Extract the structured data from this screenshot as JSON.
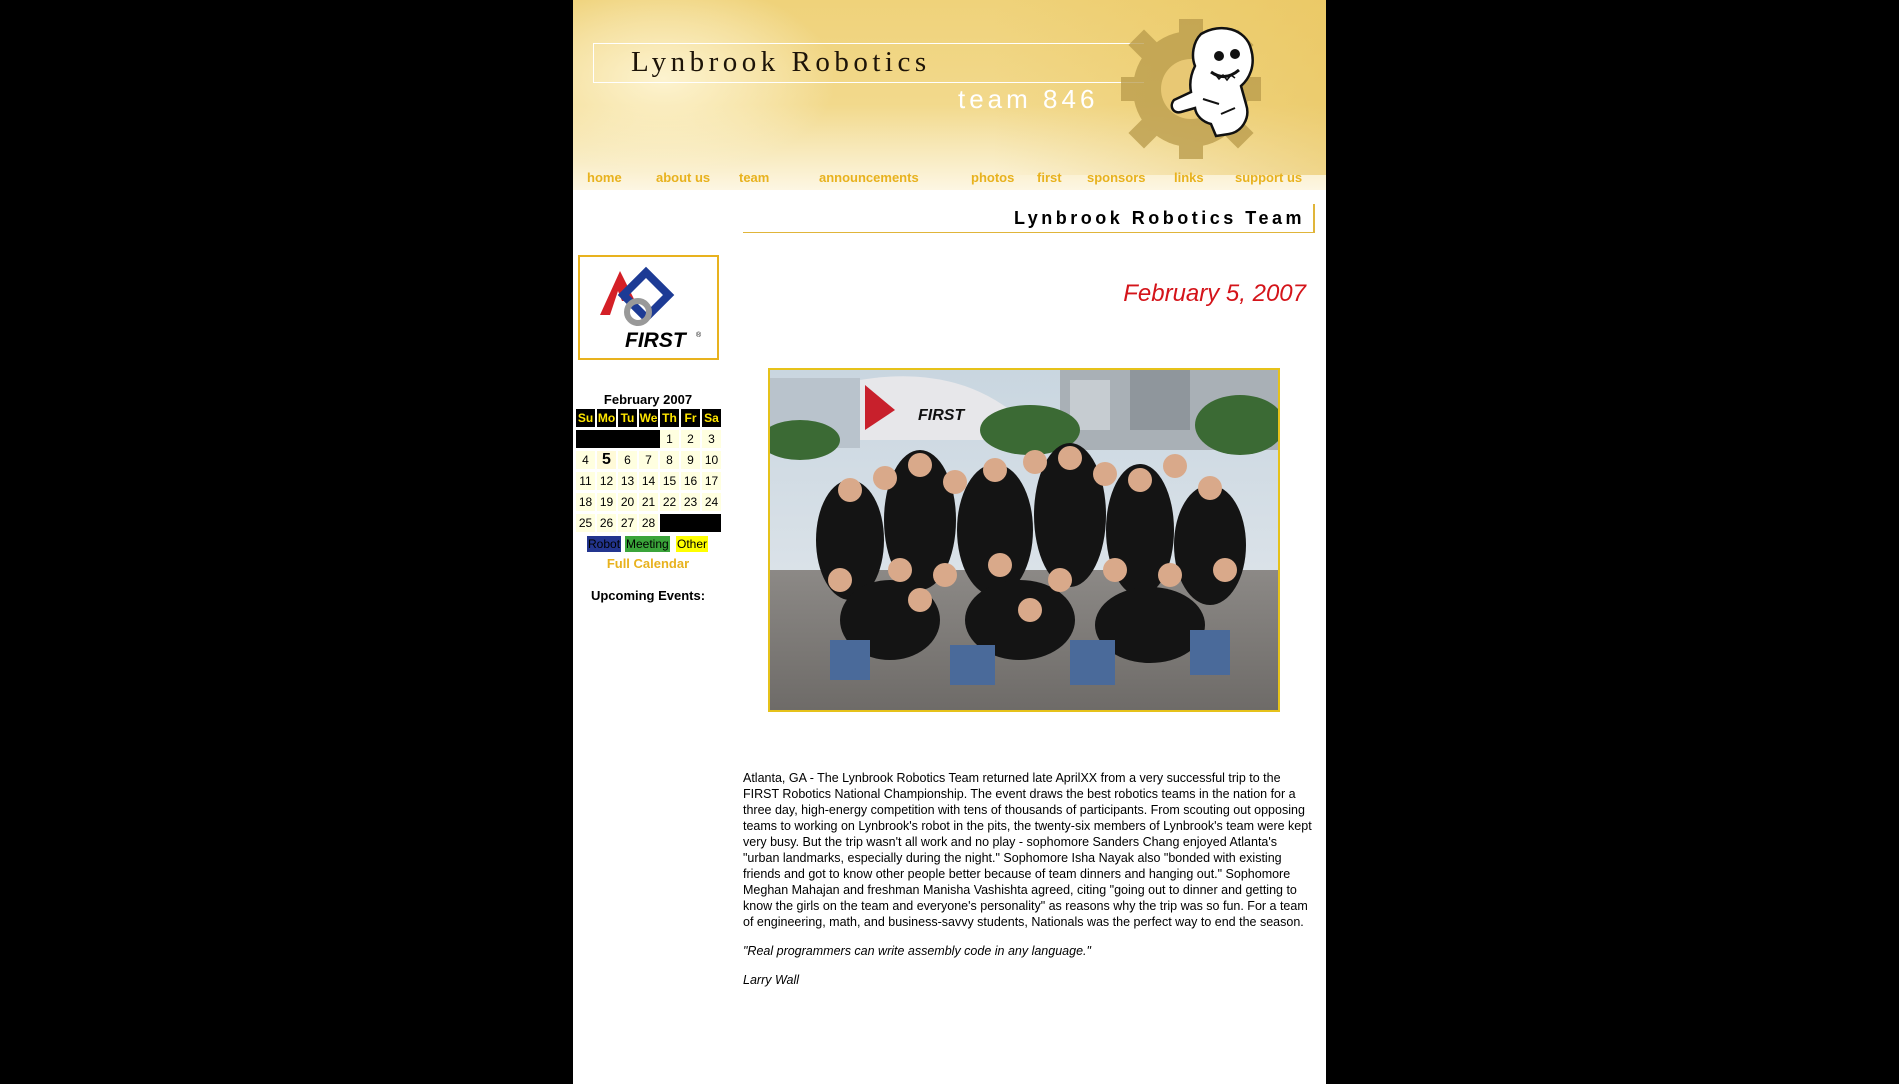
{
  "header": {
    "site_title": "Lynbrook Robotics",
    "team_number": "team 846"
  },
  "nav": {
    "items": [
      "home",
      "about us",
      "team",
      "announcements",
      "photos",
      "first",
      "sponsors",
      "links",
      "support us"
    ]
  },
  "section_title": "Lynbrook Robotics Team",
  "sidebar": {
    "logo_text": "FIRST",
    "calendar": {
      "month_label": "February 2007",
      "day_headers": [
        "Su",
        "Mo",
        "Tu",
        "We",
        "Th",
        "Fr",
        "Sa"
      ],
      "weeks": [
        [
          "",
          "",
          "",
          "",
          "1",
          "2",
          "3"
        ],
        [
          "4",
          "5",
          "6",
          "7",
          "8",
          "9",
          "10"
        ],
        [
          "11",
          "12",
          "13",
          "14",
          "15",
          "16",
          "17"
        ],
        [
          "18",
          "19",
          "20",
          "21",
          "22",
          "23",
          "24"
        ],
        [
          "25",
          "26",
          "27",
          "28",
          "",
          "",
          ""
        ]
      ],
      "today": "5",
      "legend": {
        "robot": "Robot",
        "meeting": "Meeting",
        "other": "Other"
      },
      "legend_colors": {
        "robot": "#23358f",
        "meeting": "#3aa43a",
        "other": "#ffff00"
      },
      "full_calendar_label": "Full Calendar",
      "upcoming_label": "Upcoming Events:"
    }
  },
  "main": {
    "date": "February 5, 2007",
    "photo_banner_text": "FIRST",
    "article_text": "Atlanta, GA - The Lynbrook Robotics Team returned late AprilXX from a very successful trip to the FIRST Robotics National Championship. The event draws the best robotics teams in the nation for a three day, high-energy competition with tens of thousands of participants. From scouting out opposing teams to working on Lynbrook's robot in the pits, the twenty-six members of Lynbrook's team were kept very busy. But the trip wasn't all work and no play - sophomore Sanders Chang enjoyed Atlanta's \"urban landmarks, especially during the night.\" Sophomore Isha Nayak also \"bonded with existing friends and got to know other people better because of team dinners and hanging out.\" Sophomore Meghan Mahajan and freshman Manisha Vashishta agreed, citing \"going out to dinner and getting to know the girls on the team and everyone's personality\" as reasons why the trip was so fun. For a team of engineering, math, and business-savvy students, Nationals was the perfect way to end the season.",
    "quote": "\"Real programmers can write assembly code in any language.\"",
    "quote_author": "Larry Wall"
  },
  "colors": {
    "accent": "#e8b21e",
    "date_red": "#d4141a",
    "background": "#000000"
  }
}
